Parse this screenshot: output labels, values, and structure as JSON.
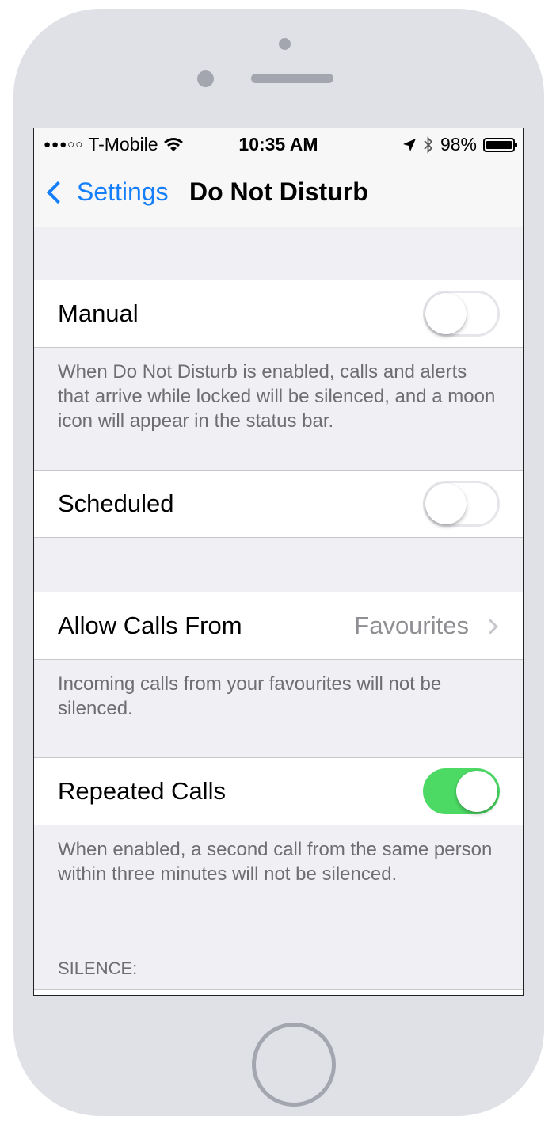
{
  "status_bar": {
    "signal": "●●●○○",
    "carrier": "T-Mobile",
    "time": "10:35 AM",
    "battery": "98%",
    "icons": [
      "wifi-icon",
      "location-icon",
      "bluetooth-icon",
      "battery-icon"
    ]
  },
  "nav": {
    "back_label": "Settings",
    "title": "Do Not Disturb"
  },
  "rows": {
    "manual": {
      "label": "Manual",
      "on": false
    },
    "manual_footer": "When Do Not Disturb is enabled, calls and alerts that arrive while locked will be silenced, and a moon icon will appear in the status bar.",
    "scheduled": {
      "label": "Scheduled",
      "on": false
    },
    "allow_calls": {
      "label": "Allow Calls From",
      "value": "Favourites"
    },
    "allow_calls_footer": "Incoming calls from your favourites will not be silenced.",
    "repeated": {
      "label": "Repeated Calls",
      "on": true
    },
    "repeated_footer": "When enabled, a second call from the same person within three minutes will not be silenced.",
    "silence_header": "SILENCE:"
  },
  "colors": {
    "accent": "#157efb",
    "toggle_on": "#4cd964",
    "background": "#efeff4"
  }
}
